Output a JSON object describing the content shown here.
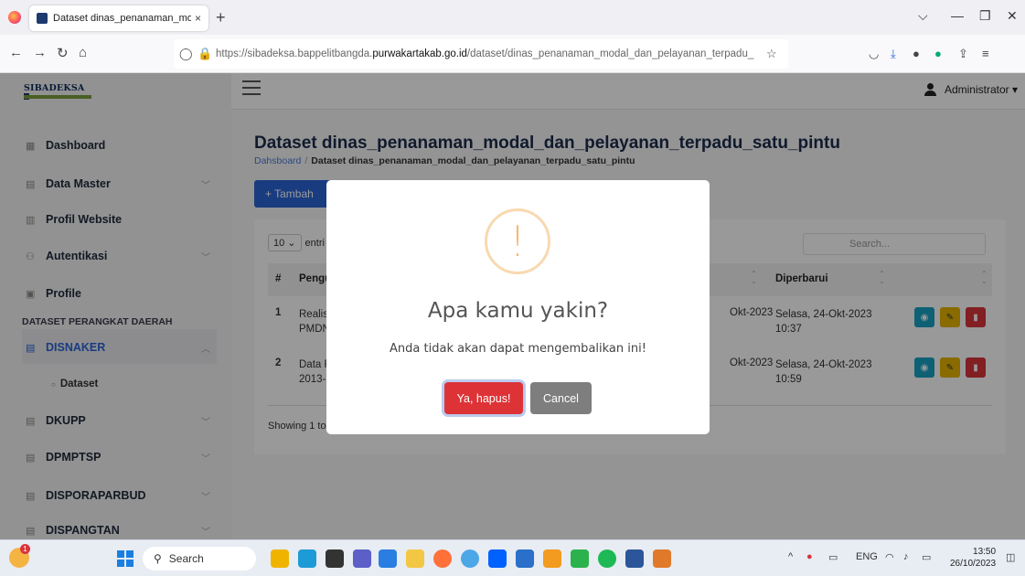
{
  "browser": {
    "tab_title": "Dataset dinas_penanaman_moc",
    "tab_close": "×",
    "new_tab": "+",
    "url_prefix": "https://sibadeksa.bappelitbangda.",
    "url_domain": "purwakartakab.go.id",
    "url_path": "/dataset/dinas_penanaman_modal_dan_pelayanan_terpadu_"
  },
  "header": {
    "brand": "SIBADEKSA",
    "user": "Administrator ▾"
  },
  "sidebar": {
    "items": [
      {
        "label": "Dashboard",
        "icon": "grid-icon"
      },
      {
        "label": "Data Master",
        "icon": "database-icon"
      },
      {
        "label": "Profil Website",
        "icon": "browser-icon"
      },
      {
        "label": "Autentikasi",
        "icon": "users-icon"
      },
      {
        "label": "Profile",
        "icon": "id-card-icon"
      }
    ],
    "section": "DATASET PERANGKAT DAERAH",
    "groups": [
      {
        "label": "DISNAKER",
        "active": true
      },
      {
        "label": "DKUPP"
      },
      {
        "label": "DPMPTSP"
      },
      {
        "label": "DISPORAPARBUD"
      },
      {
        "label": "DISPANGTAN"
      }
    ],
    "sub_item": "Dataset"
  },
  "main": {
    "title": "Dataset dinas_penanaman_modal_dan_pelayanan_terpadu_satu_pintu",
    "breadcrumb_home": "Dahsboard",
    "breadcrumb_sep": "/",
    "breadcrumb_current": "Dataset dinas_penanaman_modal_dan_pelayanan_terpadu_satu_pintu",
    "add_button": "+ Tambah",
    "length_value": "10",
    "length_label": "entri",
    "search_placeholder": "Search...",
    "columns": [
      "#",
      "Pengu",
      "Diperbarui"
    ],
    "rows": [
      {
        "no": "1",
        "name": "Realisa PMDN",
        "created": "Okt-2023",
        "updated": "Selasa, 24-Okt-2023 10:37"
      },
      {
        "no": "2",
        "name": "Data R 2013-",
        "created": "Okt-2023",
        "updated": "Selasa, 24-Okt-2023 10:59"
      }
    ],
    "showing": "Showing 1 to"
  },
  "modal": {
    "icon": "!",
    "title": "Apa kamu yakin?",
    "text": "Anda tidak akan dapat mengembalikan ini!",
    "confirm": "Ya, hapus!",
    "cancel": "Cancel"
  },
  "taskbar": {
    "badge": "1",
    "search": "Search",
    "lang": "ENG",
    "time": "13:50",
    "date": "26/10/2023"
  }
}
